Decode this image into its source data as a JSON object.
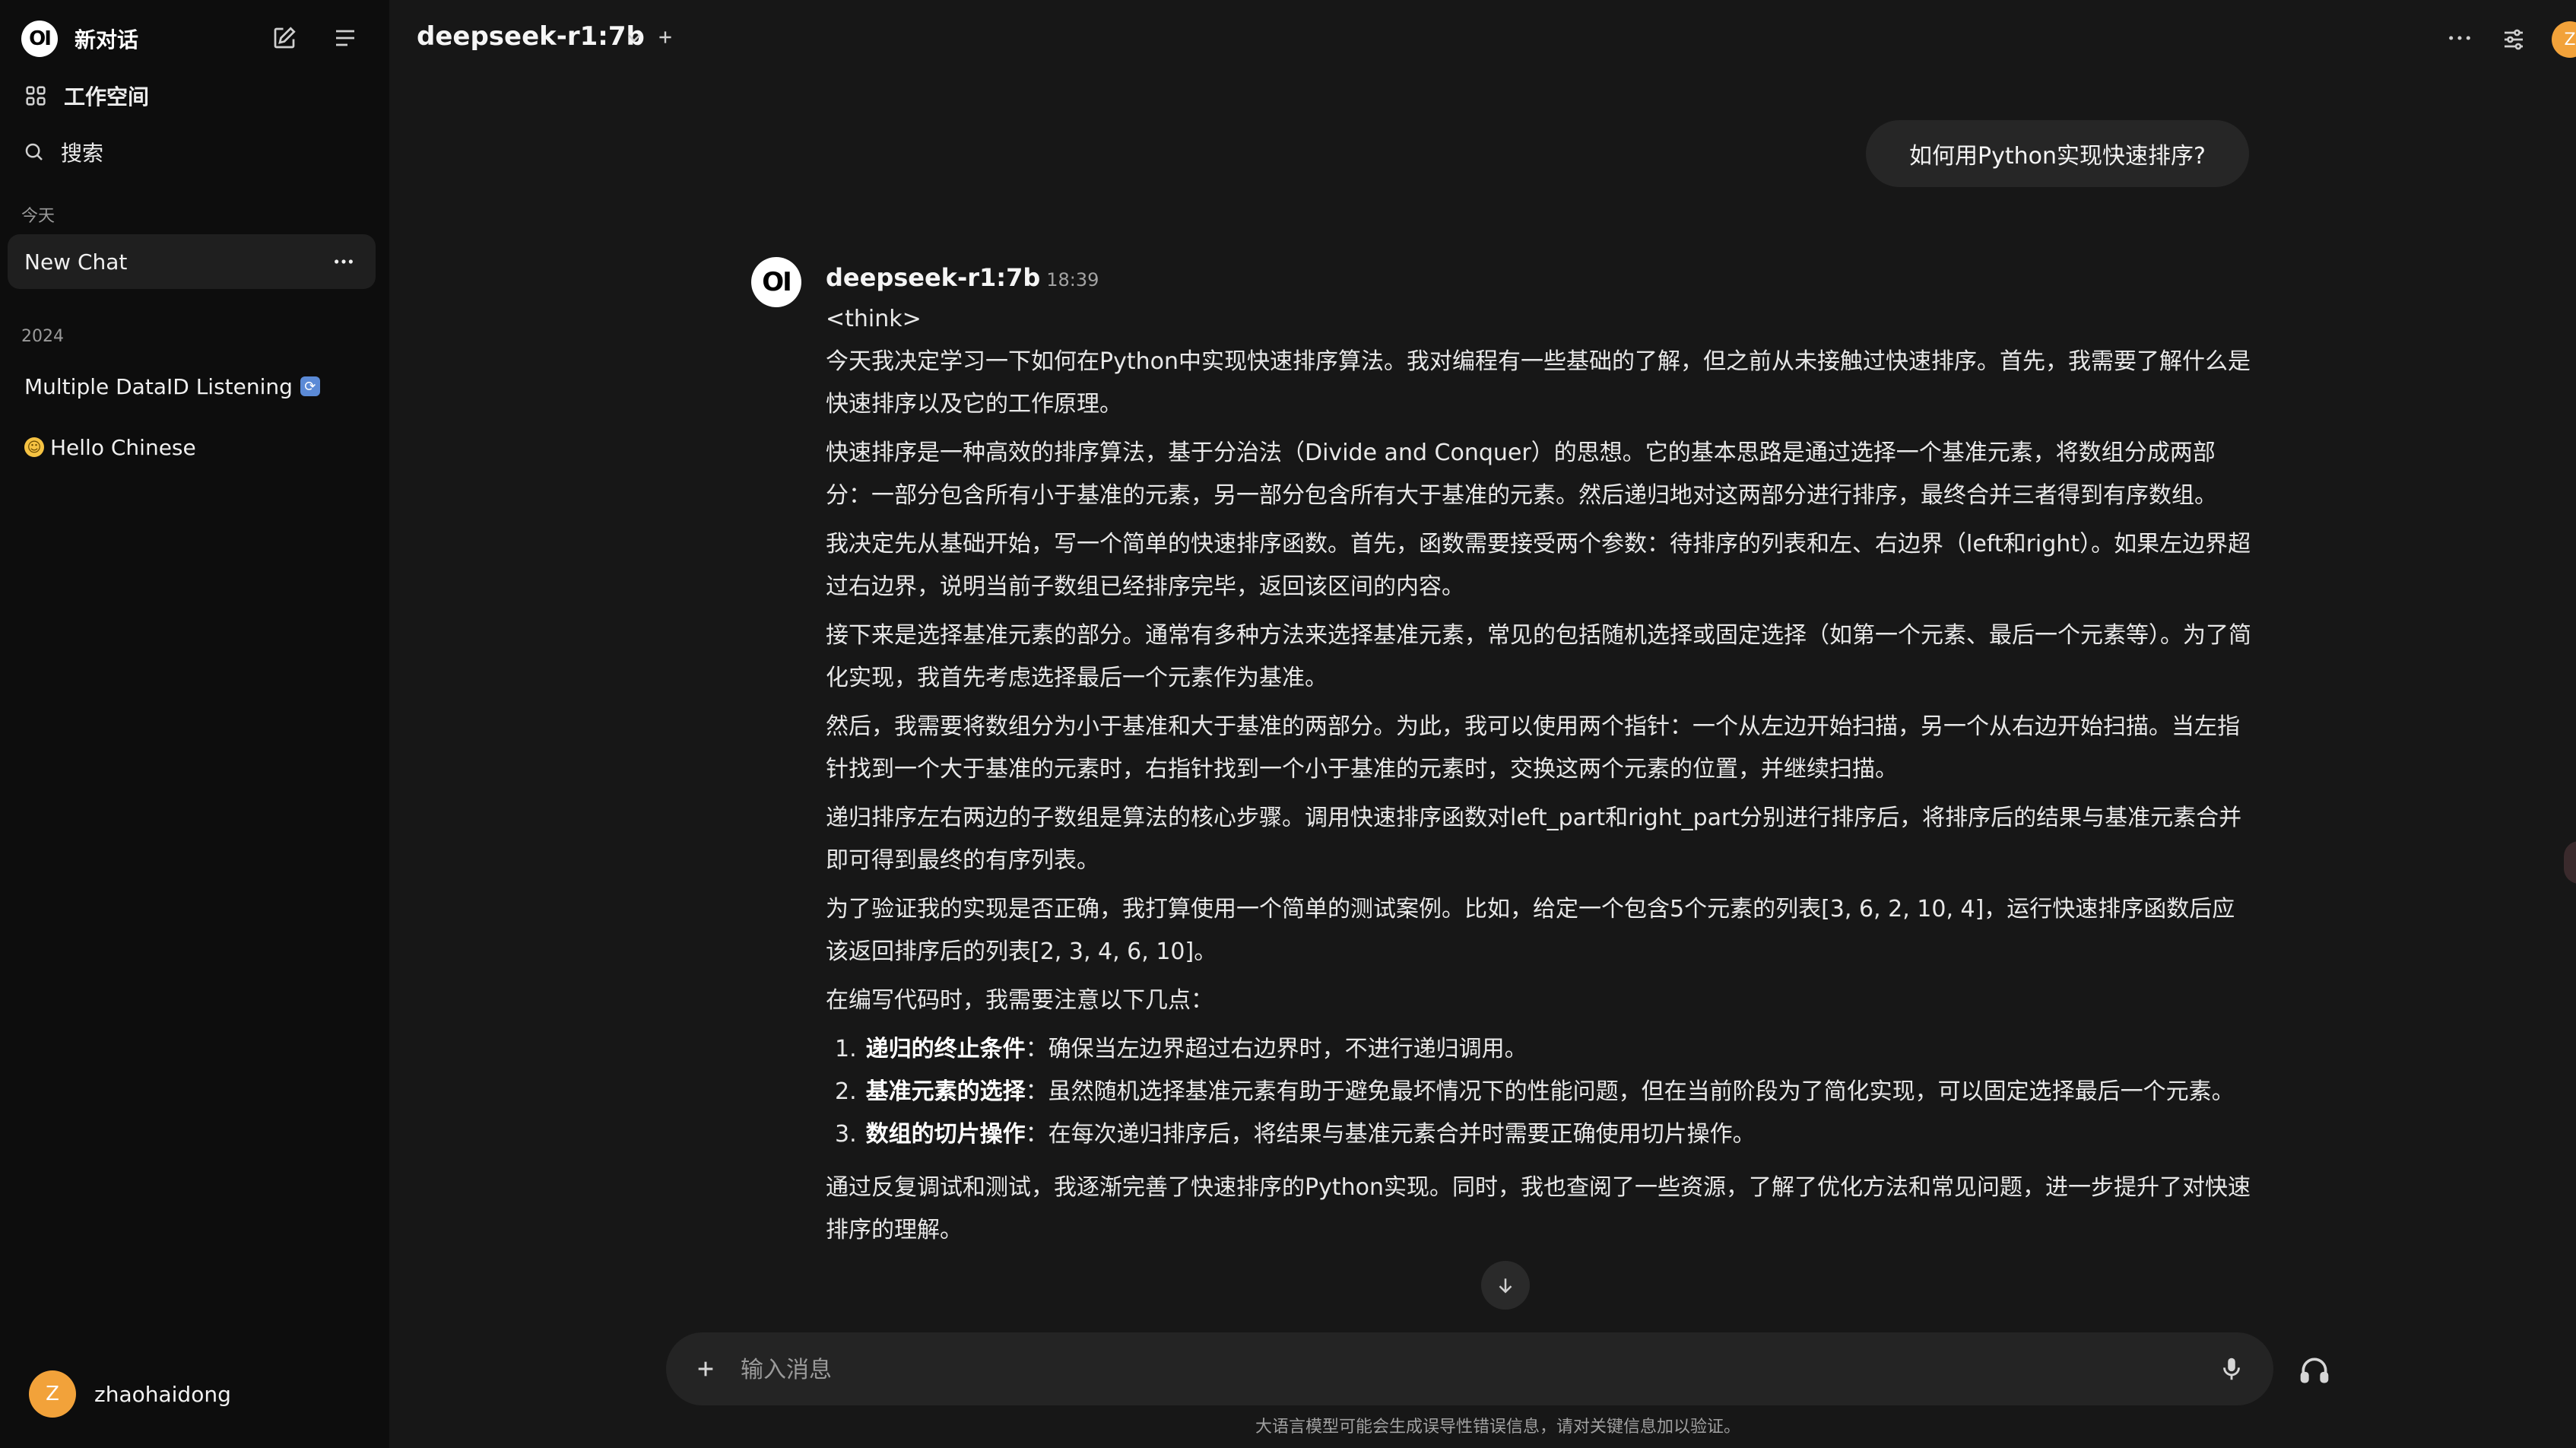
{
  "sidebar": {
    "title": "新对话",
    "workspace_label": "工作空间",
    "search_label": "搜索",
    "section_today": "今天",
    "section_year": "2024",
    "chats_today": [
      {
        "label": "New Chat"
      }
    ],
    "chats_2024": [
      {
        "label": "Multiple DataID Listening"
      },
      {
        "label": "Hello Chinese"
      }
    ],
    "user": {
      "initial": "Z",
      "name": "zhaohaidong"
    }
  },
  "header": {
    "model": "deepseek-r1:7b",
    "user_initial": "Z"
  },
  "conversation": {
    "user_message": "如何用Python实现快速排序?",
    "bot_name": "deepseek-r1:7b",
    "bot_time": "18:39",
    "bot_think_tag": "<think>",
    "paragraphs": [
      "今天我决定学习一下如何在Python中实现快速排序算法。我对编程有一些基础的了解，但之前从未接触过快速排序。首先，我需要了解什么是快速排序以及它的工作原理。",
      "快速排序是一种高效的排序算法，基于分治法（Divide and Conquer）的思想。它的基本思路是通过选择一个基准元素，将数组分成两部分：一部分包含所有小于基准的元素，另一部分包含所有大于基准的元素。然后递归地对这两部分进行排序，最终合并三者得到有序数组。",
      "我决定先从基础开始，写一个简单的快速排序函数。首先，函数需要接受两个参数：待排序的列表和左、右边界（left和right）。如果左边界超过右边界，说明当前子数组已经排序完毕，返回该区间的内容。",
      "接下来是选择基准元素的部分。通常有多种方法来选择基准元素，常见的包括随机选择或固定选择（如第一个元素、最后一个元素等）。为了简化实现，我首先考虑选择最后一个元素作为基准。",
      "然后，我需要将数组分为小于基准和大于基准的两部分。为此，我可以使用两个指针：一个从左边开始扫描，另一个从右边开始扫描。当左指针找到一个大于基准的元素时，右指针找到一个小于基准的元素时，交换这两个元素的位置，并继续扫描。",
      "递归排序左右两边的子数组是算法的核心步骤。调用快速排序函数对left_part和right_part分别进行排序后，将排序后的结果与基准元素合并即可得到最终的有序列表。",
      "为了验证我的实现是否正确，我打算使用一个简单的测试案例。比如，给定一个包含5个元素的列表[3, 6, 2, 10, 4]，运行快速排序函数后应该返回排序后的列表[2, 3, 4, 6, 10]。",
      "在编写代码时，我需要注意以下几点："
    ],
    "list_items": [
      {
        "num": "1.",
        "title": "递归的终止条件",
        "text": "：确保当左边界超过右边界时，不进行递归调用。"
      },
      {
        "num": "2.",
        "title": "基准元素的选择",
        "text": "：虽然随机选择基准元素有助于避免最坏情况下的性能问题，但在当前阶段为了简化实现，可以固定选择最后一个元素。"
      },
      {
        "num": "3.",
        "title": "数组的切片操作",
        "text": "：在每次递归排序后，将结果与基准元素合并时需要正确使用切片操作。"
      }
    ],
    "closing": "通过反复调试和测试，我逐渐完善了快速排序的Python实现。同时，我也查阅了一些资源，了解了优化方法和常见问题，进一步提升了对快速排序的理解。"
  },
  "input": {
    "placeholder": "输入消息"
  },
  "footer": {
    "disclaimer": "大语言模型可能会生成误导性错误信息，请对关键信息加以验证。"
  },
  "colors": {
    "background": "#171717",
    "sidebar": "#0d0d0d",
    "avatar": "#f2a23a"
  }
}
